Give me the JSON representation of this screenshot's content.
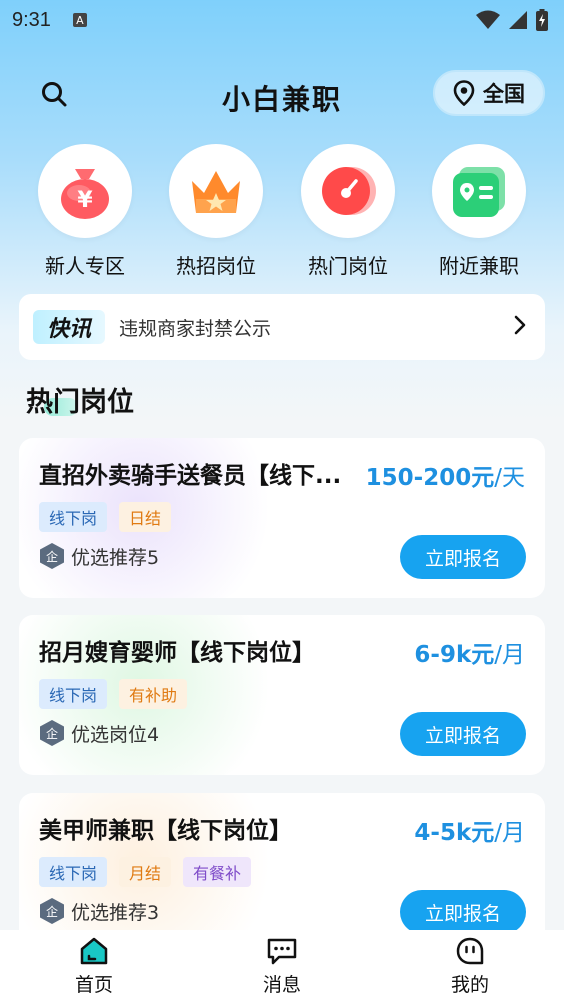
{
  "status_bar": {
    "time": "9:31",
    "notif_letter": "A"
  },
  "header": {
    "title": "小白兼职",
    "location_label": "全国"
  },
  "categories": [
    {
      "label": "新人专区",
      "icon": "money-bag-icon",
      "color": "#ff5b62"
    },
    {
      "label": "热招岗位",
      "icon": "crown-icon",
      "color": "#ff8a2c"
    },
    {
      "label": "热门岗位",
      "icon": "gauge-icon",
      "color": "#ff4a4a"
    },
    {
      "label": "附近兼职",
      "icon": "id-card-icon",
      "color": "#2ccf78"
    }
  ],
  "news": {
    "tag": "快讯",
    "text": "违规商家封禁公示"
  },
  "section_title": "热门岗位",
  "jobs": [
    {
      "title": "直招外卖骑手送餐员【线下...",
      "salary": "150-200元",
      "unit": "/天",
      "tags": [
        {
          "label": "线下岗",
          "style": "blue"
        },
        {
          "label": "日结",
          "style": "orange"
        }
      ],
      "company": "优选推荐5",
      "apply_label": "立即报名"
    },
    {
      "title": "招月嫂育婴师【线下岗位】",
      "salary": "6-9k元",
      "unit": "/月",
      "tags": [
        {
          "label": "线下岗",
          "style": "blue"
        },
        {
          "label": "有补助",
          "style": "orange"
        }
      ],
      "company": "优选岗位4",
      "apply_label": "立即报名"
    },
    {
      "title": "美甲师兼职【线下岗位】",
      "salary": "4-5k元",
      "unit": "/月",
      "tags": [
        {
          "label": "线下岗",
          "style": "blue"
        },
        {
          "label": "月结",
          "style": "orange"
        },
        {
          "label": "有餐补",
          "style": "purple"
        }
      ],
      "company": "优选推荐3",
      "apply_label": "立即报名"
    }
  ],
  "company_badge": "企",
  "tab_bar": [
    {
      "label": "首页",
      "icon": "home-icon"
    },
    {
      "label": "消息",
      "icon": "message-icon"
    },
    {
      "label": "我的",
      "icon": "profile-icon"
    }
  ],
  "colors": {
    "accent": "#17a3f0",
    "salary": "#1e90e0"
  }
}
